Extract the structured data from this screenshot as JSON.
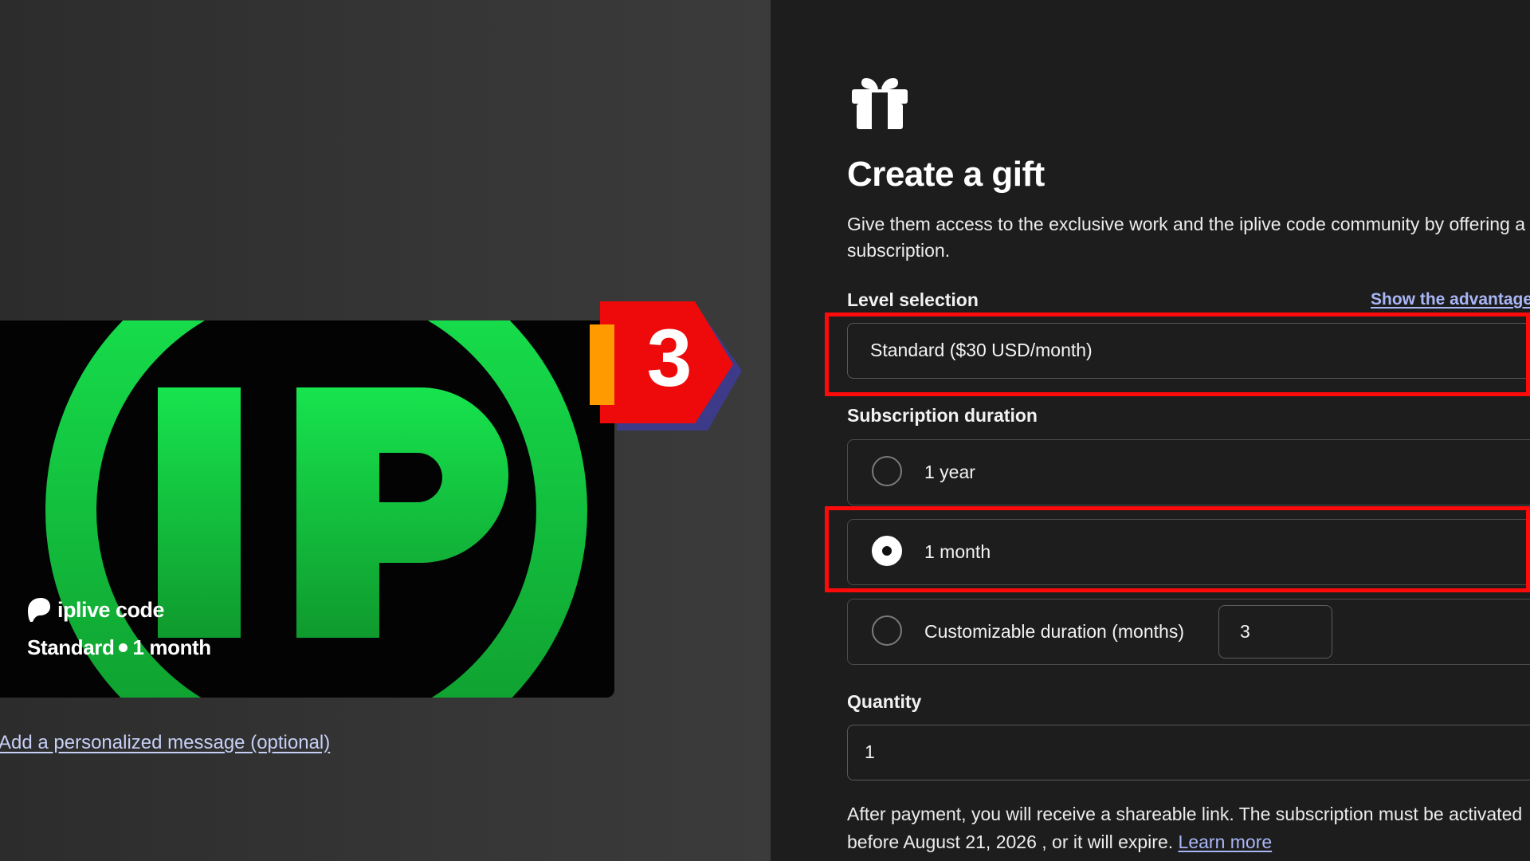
{
  "card": {
    "brand": "iplive code",
    "tier": "Standard",
    "duration": "1 month"
  },
  "personal_message_link": "Add a personalized message (optional)",
  "step_badge": "3",
  "form": {
    "title": "Create a gift",
    "description": "Give them access to the exclusive work and the iplive code community by offering a subscription.",
    "level_label": "Level selection",
    "advantages_link": "Show the advantages",
    "level_value": "Standard ($30 USD/month)",
    "duration_label": "Subscription duration",
    "options": [
      {
        "label": "1 year",
        "checked": false
      },
      {
        "label": "1 month",
        "checked": true
      },
      {
        "label": "Customizable duration (months)",
        "checked": false
      }
    ],
    "custom_months_value": "3",
    "quantity_label": "Quantity",
    "quantity_value": "1",
    "note_line1": "After payment, you will receive a shareable link. The subscription must be activated",
    "note_line2": "before August 21, 2026 , or it will expire.",
    "learn_more": "Learn more"
  },
  "colors": {
    "highlight": "#ff0a0a",
    "card_green": "#16e04c",
    "link": "#a9b6f6",
    "badge_red": "#ee0a0a",
    "badge_orange": "#ff9a00",
    "badge_shadow": "#3d3a8a"
  }
}
